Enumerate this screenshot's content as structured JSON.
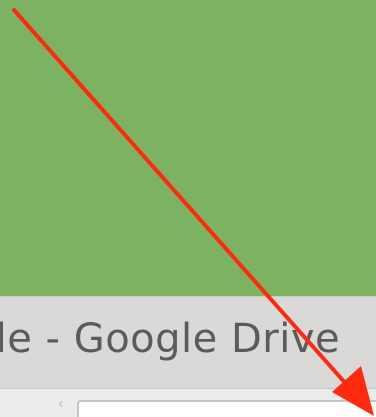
{
  "window": {
    "title": "ile - Google Drive"
  },
  "colors": {
    "background": "#7cb262",
    "title_bar": "#d9dad8",
    "arrow": "#ff2a0d"
  },
  "annotation": {
    "type": "arrow",
    "icon": "red-arrow-icon"
  }
}
